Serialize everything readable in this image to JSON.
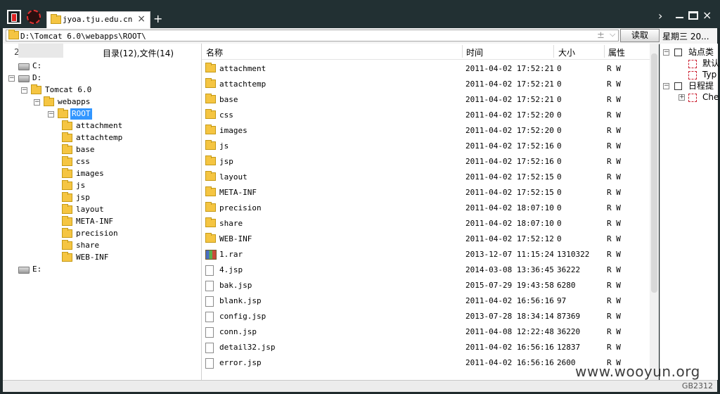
{
  "tab": {
    "title": "jyoa.tju.edu.cn",
    "close": "×",
    "new": "+"
  },
  "window": {
    "more": "›",
    "close": "×"
  },
  "address": {
    "path": "D:\\Tomcat 6.0\\webapps\\ROOT\\",
    "plus": "±",
    "dropdown": "⌵",
    "read_button": "读取",
    "date": "星期三  20..."
  },
  "tree": {
    "ip": "22             8",
    "summary": "目录(12),文件(14)",
    "nodes": [
      {
        "label": "C:",
        "type": "drive",
        "toggle": ""
      },
      {
        "label": "D:",
        "type": "drive",
        "toggle": "−"
      },
      {
        "label": "Tomcat 6.0",
        "type": "folder",
        "toggle": "−"
      },
      {
        "label": "webapps",
        "type": "folder",
        "toggle": "−"
      },
      {
        "label": "ROOT",
        "type": "folder",
        "toggle": "−",
        "selected": true
      },
      {
        "label": "attachment",
        "type": "folder"
      },
      {
        "label": "attachtemp",
        "type": "folder"
      },
      {
        "label": "base",
        "type": "folder"
      },
      {
        "label": "css",
        "type": "folder"
      },
      {
        "label": "images",
        "type": "folder"
      },
      {
        "label": "js",
        "type": "folder"
      },
      {
        "label": "jsp",
        "type": "folder"
      },
      {
        "label": "layout",
        "type": "folder"
      },
      {
        "label": "META-INF",
        "type": "folder"
      },
      {
        "label": "precision",
        "type": "folder"
      },
      {
        "label": "share",
        "type": "folder"
      },
      {
        "label": "WEB-INF",
        "type": "folder"
      },
      {
        "label": "E:",
        "type": "drive",
        "toggle": ""
      }
    ]
  },
  "list": {
    "headers": {
      "name": "名称",
      "time": "时间",
      "size": "大小",
      "attr": "属性"
    },
    "rows": [
      {
        "name": "attachment",
        "time": "2011-04-02 17:52:21",
        "size": "0",
        "attr": "R W",
        "type": "folder"
      },
      {
        "name": "attachtemp",
        "time": "2011-04-02 17:52:21",
        "size": "0",
        "attr": "R W",
        "type": "folder"
      },
      {
        "name": "base",
        "time": "2011-04-02 17:52:21",
        "size": "0",
        "attr": "R W",
        "type": "folder"
      },
      {
        "name": "css",
        "time": "2011-04-02 17:52:20",
        "size": "0",
        "attr": "R W",
        "type": "folder"
      },
      {
        "name": "images",
        "time": "2011-04-02 17:52:20",
        "size": "0",
        "attr": "R W",
        "type": "folder"
      },
      {
        "name": "js",
        "time": "2011-04-02 17:52:16",
        "size": "0",
        "attr": "R W",
        "type": "folder"
      },
      {
        "name": "jsp",
        "time": "2011-04-02 17:52:16",
        "size": "0",
        "attr": "R W",
        "type": "folder"
      },
      {
        "name": "layout",
        "time": "2011-04-02 17:52:15",
        "size": "0",
        "attr": "R W",
        "type": "folder"
      },
      {
        "name": "META-INF",
        "time": "2011-04-02 17:52:15",
        "size": "0",
        "attr": "R W",
        "type": "folder"
      },
      {
        "name": "precision",
        "time": "2011-04-02 18:07:10",
        "size": "0",
        "attr": "R W",
        "type": "folder"
      },
      {
        "name": "share",
        "time": "2011-04-02 18:07:10",
        "size": "0",
        "attr": "R W",
        "type": "folder"
      },
      {
        "name": "WEB-INF",
        "time": "2011-04-02 17:52:12",
        "size": "0",
        "attr": "R W",
        "type": "folder"
      },
      {
        "name": "1.rar",
        "time": "2013-12-07 11:15:24",
        "size": "1310322",
        "attr": "R W",
        "type": "rar"
      },
      {
        "name": "4.jsp",
        "time": "2014-03-08 13:36:45",
        "size": "36222",
        "attr": "R W",
        "type": "file"
      },
      {
        "name": "bak.jsp",
        "time": "2015-07-29 19:43:58",
        "size": "6280",
        "attr": "R W",
        "type": "file"
      },
      {
        "name": "blank.jsp",
        "time": "2011-04-02 16:56:16",
        "size": "97",
        "attr": "R W",
        "type": "file"
      },
      {
        "name": "config.jsp",
        "time": "2013-07-28 18:34:14",
        "size": "87369",
        "attr": "R W",
        "type": "file"
      },
      {
        "name": "conn.jsp",
        "time": "2011-04-08 12:22:48",
        "size": "36220",
        "attr": "R W",
        "type": "file"
      },
      {
        "name": "detail32.jsp",
        "time": "2011-04-02 16:56:16",
        "size": "12837",
        "attr": "R W",
        "type": "file"
      },
      {
        "name": "error.jsp",
        "time": "2011-04-02 16:56:16",
        "size": "2600",
        "attr": "R W",
        "type": "file"
      }
    ]
  },
  "sidebar": {
    "items": [
      {
        "label": "站点类",
        "toggle": "−",
        "level": 0,
        "icon": "box"
      },
      {
        "label": "默认",
        "level": 1,
        "icon": "red"
      },
      {
        "label": "Typ",
        "level": 1,
        "icon": "red"
      },
      {
        "label": "日程提",
        "toggle": "−",
        "level": 0,
        "icon": "box"
      },
      {
        "label": "Che",
        "toggle": "+",
        "level": 1,
        "icon": "red"
      }
    ]
  },
  "status": {
    "encoding": "GB2312"
  },
  "watermark": "www.wooyun.org",
  "colors": {
    "title_bg": "#223033",
    "selection": "#3296ff",
    "folder": "#f5c542"
  }
}
